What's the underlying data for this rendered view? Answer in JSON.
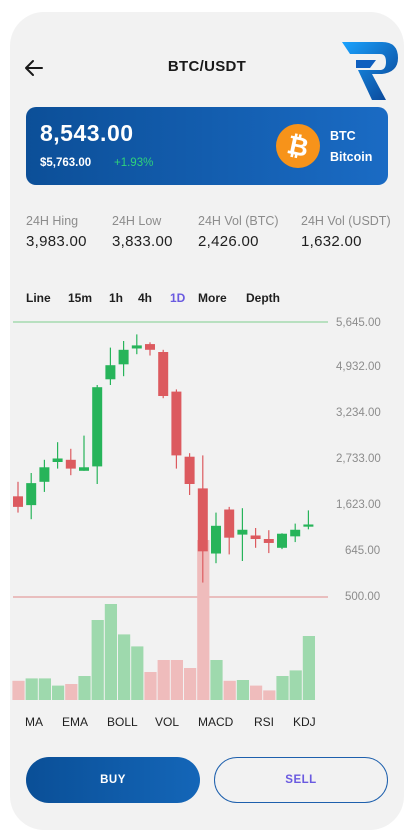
{
  "header": {
    "title": "BTC/USDT",
    "back_icon": "arrow-left-icon",
    "logo_icon": "r-brand-logo"
  },
  "price_card": {
    "price": "8,543.00",
    "usd_value": "$5,763.00",
    "change": "+1.93%",
    "coin_icon": "bitcoin-icon",
    "coin_symbol": "BTC",
    "coin_name": "Bitcoin"
  },
  "stats": [
    {
      "label": "24H Hing",
      "value": "3,983.00"
    },
    {
      "label": "24H Low",
      "value": "3,833.00"
    },
    {
      "label": "24H Vol (BTC)",
      "value": "2,426.00"
    },
    {
      "label": "24H Vol (USDT)",
      "value": "1,632.00"
    }
  ],
  "timeframes": [
    "Line",
    "15m",
    "1h",
    "4h",
    "1D",
    "More",
    "Depth"
  ],
  "active_timeframe": "1D",
  "indicators": [
    "MA",
    "EMA",
    "BOLL",
    "VOL",
    "MACD",
    "RSI",
    "KDJ"
  ],
  "actions": {
    "buy": "BUY",
    "sell": "SELL"
  },
  "colors": {
    "up": "#27b45a",
    "down": "#dc5a5f",
    "vol_up": "#9ed9ad",
    "vol_down": "#efbcbc",
    "accent": "#6a5ae0",
    "brand": "#0c4f98"
  },
  "chart_data": {
    "type": "candlestick",
    "y_tick_labels": [
      "5,645.00",
      "4,932.00",
      "3,234.00",
      "2,733.00",
      "1,623.00",
      "645.00",
      "500.00"
    ],
    "reference_lines": [
      {
        "label": "5,645.00",
        "color": "green"
      },
      {
        "label": "500.00",
        "color": "red"
      }
    ],
    "candles": [
      {
        "dir": "down",
        "open": 1.72,
        "close": 1.48,
        "high": 2.05,
        "low": 1.35,
        "vol": 0.24
      },
      {
        "dir": "up",
        "open": 1.52,
        "close": 2.02,
        "high": 2.25,
        "low": 1.2,
        "vol": 0.27
      },
      {
        "dir": "up",
        "open": 2.05,
        "close": 2.38,
        "high": 2.55,
        "low": 1.82,
        "vol": 0.27
      },
      {
        "dir": "up",
        "open": 2.5,
        "close": 2.58,
        "high": 2.95,
        "low": 2.35,
        "vol": 0.18
      },
      {
        "dir": "down",
        "open": 2.55,
        "close": 2.35,
        "high": 2.8,
        "low": 2.2,
        "vol": 0.2
      },
      {
        "dir": "up",
        "open": 2.3,
        "close": 2.38,
        "high": 3.1,
        "low": 2.3,
        "vol": 0.3
      },
      {
        "dir": "up",
        "open": 2.4,
        "close": 4.2,
        "high": 4.25,
        "low": 2.0,
        "vol": 1.0
      },
      {
        "dir": "up",
        "open": 4.38,
        "close": 4.7,
        "high": 5.1,
        "low": 4.25,
        "vol": 1.2
      },
      {
        "dir": "up",
        "open": 4.72,
        "close": 5.05,
        "high": 5.25,
        "low": 4.45,
        "vol": 0.82
      },
      {
        "dir": "up",
        "open": 5.08,
        "close": 5.15,
        "high": 5.4,
        "low": 4.95,
        "vol": 0.67
      },
      {
        "dir": "down",
        "open": 5.18,
        "close": 5.05,
        "high": 5.22,
        "low": 4.92,
        "vol": 0.35
      },
      {
        "dir": "down",
        "open": 5.0,
        "close": 4.0,
        "high": 5.05,
        "low": 3.95,
        "vol": 0.5
      },
      {
        "dir": "down",
        "open": 4.1,
        "close": 2.65,
        "high": 4.15,
        "low": 2.35,
        "vol": 0.5
      },
      {
        "dir": "down",
        "open": 2.62,
        "close": 2.0,
        "high": 2.7,
        "low": 1.75,
        "vol": 0.4
      },
      {
        "dir": "down",
        "open": 1.9,
        "close": 0.47,
        "high": 2.65,
        "low": -0.24,
        "vol": 2.0
      },
      {
        "dir": "up",
        "open": 0.42,
        "close": 1.05,
        "high": 1.35,
        "low": 0.2,
        "vol": 0.5
      },
      {
        "dir": "down",
        "open": 1.42,
        "close": 0.78,
        "high": 1.48,
        "low": 0.4,
        "vol": 0.24
      },
      {
        "dir": "up",
        "open": 0.85,
        "close": 0.96,
        "high": 1.45,
        "low": 0.25,
        "vol": 0.25
      },
      {
        "dir": "down",
        "open": 0.83,
        "close": 0.75,
        "high": 1.0,
        "low": 0.55,
        "vol": 0.18
      },
      {
        "dir": "down",
        "open": 0.75,
        "close": 0.66,
        "high": 0.95,
        "low": 0.43,
        "vol": 0.12
      },
      {
        "dir": "up",
        "open": 0.55,
        "close": 0.87,
        "high": 0.88,
        "low": 0.52,
        "vol": 0.3
      },
      {
        "dir": "up",
        "open": 0.81,
        "close": 0.96,
        "high": 1.1,
        "low": 0.68,
        "vol": 0.37
      },
      {
        "dir": "up",
        "open": 1.03,
        "close": 1.08,
        "high": 1.4,
        "low": 0.97,
        "vol": 0.8
      }
    ],
    "grid": false
  }
}
